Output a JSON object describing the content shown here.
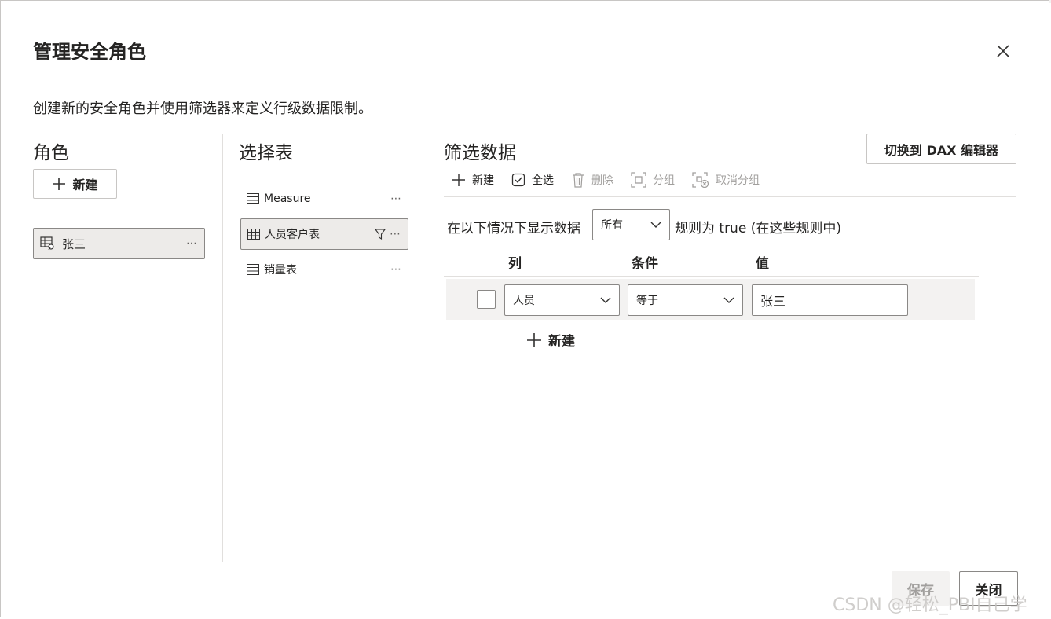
{
  "dialog": {
    "title": "管理安全角色",
    "subtitle": "创建新的安全角色并使用筛选器来定义行级数据限制。"
  },
  "roles": {
    "heading": "角色",
    "new_label": "新建",
    "items": [
      {
        "label": "张三"
      }
    ]
  },
  "tables": {
    "heading": "选择表",
    "items": [
      {
        "label": "Measure"
      },
      {
        "label": "人员客户表"
      },
      {
        "label": "销量表"
      }
    ]
  },
  "filter": {
    "heading": "筛选数据",
    "dax_button": "切换到 DAX 编辑器",
    "toolbar": {
      "new": "新建",
      "select_all": "全选",
      "delete": "删除",
      "group": "分组",
      "ungroup": "取消分组"
    },
    "rule_prefix": "在以下情况下显示数据",
    "match_mode": "所有",
    "rule_suffix": "规则为 true (在这些规则中)",
    "columns": {
      "column": "列",
      "condition": "条件",
      "value": "值"
    },
    "rules": [
      {
        "column": "人员",
        "condition": "等于",
        "value": "张三",
        "checked": false
      }
    ],
    "add_rule": "新建"
  },
  "footer": {
    "save": "保存",
    "close": "关闭"
  },
  "watermark": "CSDN @轻松_PBI自己学",
  "colors": {
    "selected_bg": "#edebe9",
    "border": "#8a8886",
    "disabled_text": "#a19f9d"
  }
}
